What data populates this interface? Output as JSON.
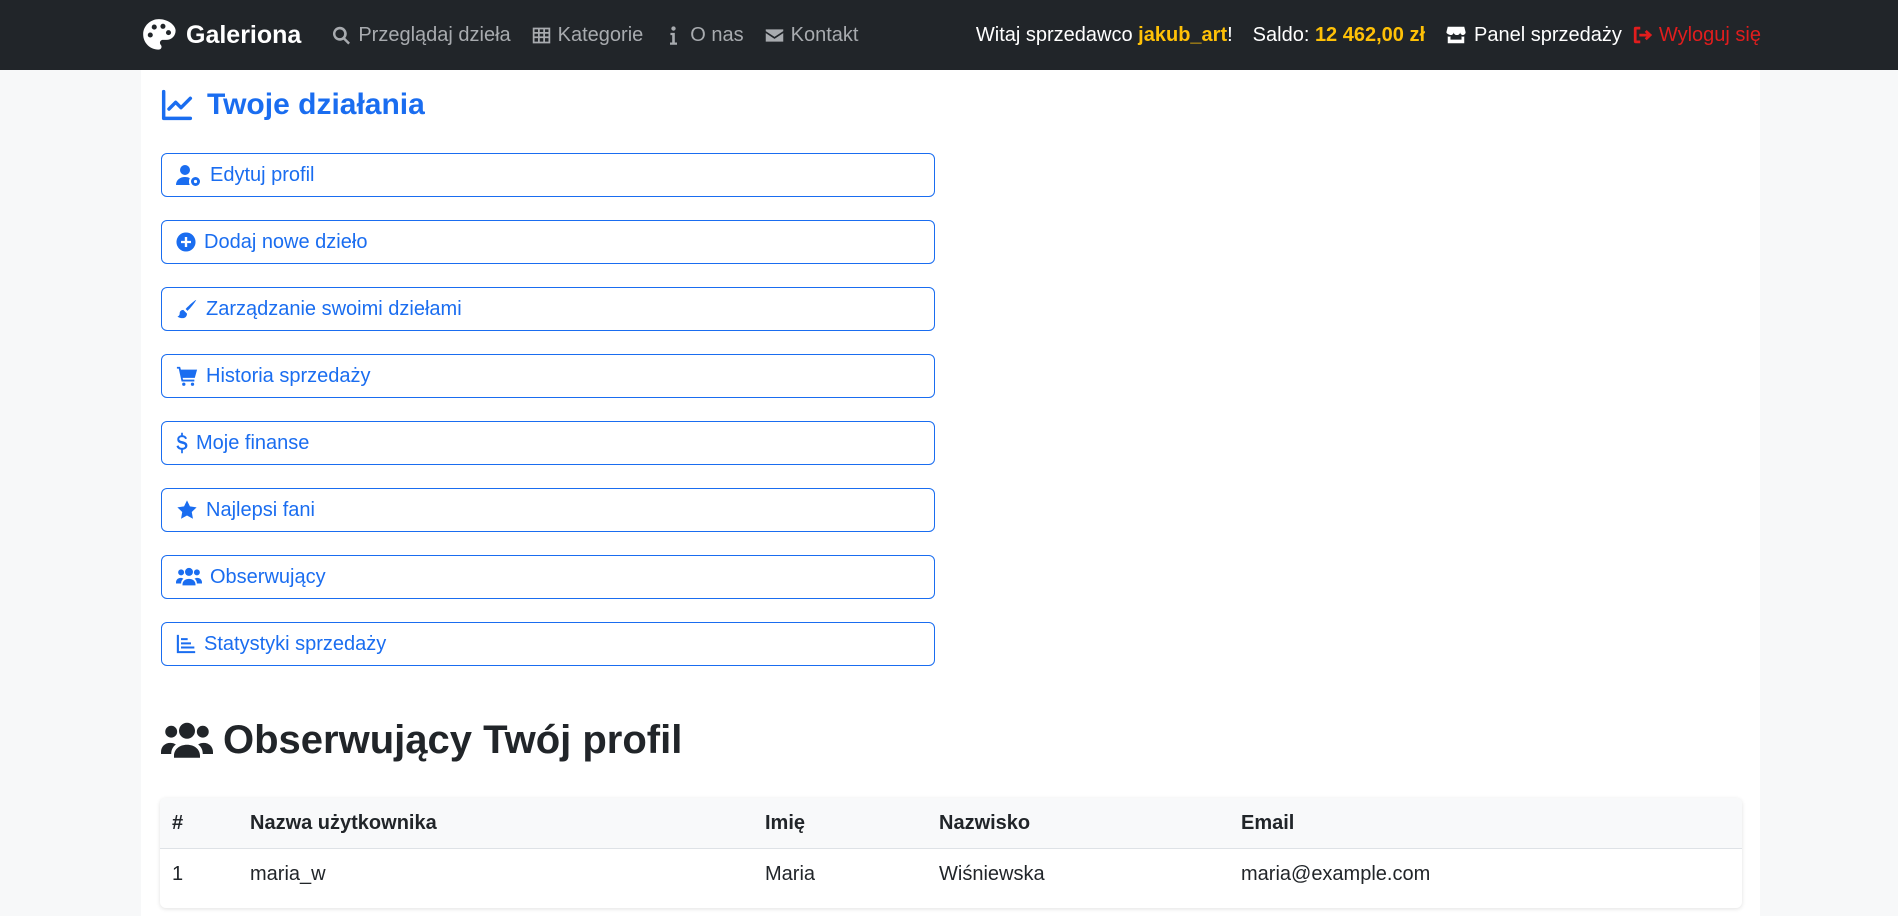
{
  "colors": {
    "navbar_bg": "#212529",
    "accent": "#1a6df0",
    "highlight": "#ffc107",
    "logout": "#e11d1d"
  },
  "navbar": {
    "brand": "Galeriona",
    "links": [
      {
        "label": "Przeglądaj dzieła",
        "icon": "search-icon"
      },
      {
        "label": "Kategorie",
        "icon": "grid-icon"
      },
      {
        "label": "O nas",
        "icon": "info-icon"
      },
      {
        "label": "Kontakt",
        "icon": "envelope-icon"
      }
    ],
    "greeting": "Witaj sprzedawco ",
    "username": "jakub_art",
    "greeting_suffix": "!",
    "balance_label": "Saldo: ",
    "balance_value": "12 462,00 zł",
    "panel_label": "Panel sprzedaży",
    "logout_label": "Wyloguj się"
  },
  "actions": {
    "title": "Twoje działania",
    "items": [
      {
        "label": "Edytuj profil",
        "icon": "user-gear-icon"
      },
      {
        "label": "Dodaj nowe dzieło",
        "icon": "plus-circle-icon"
      },
      {
        "label": "Zarządzanie swoimi dziełami",
        "icon": "brush-icon"
      },
      {
        "label": "Historia sprzedaży",
        "icon": "cart-icon"
      },
      {
        "label": "Moje finanse",
        "icon": "dollar-icon"
      },
      {
        "label": "Najlepsi fani",
        "icon": "star-icon"
      },
      {
        "label": "Obserwujący",
        "icon": "users-icon"
      },
      {
        "label": "Statystyki sprzedaży",
        "icon": "chart-bar-icon"
      }
    ]
  },
  "followers": {
    "title": "Obserwujący Twój profil",
    "columns": [
      "#",
      "Nazwa użytkownika",
      "Imię",
      "Nazwisko",
      "Email"
    ],
    "rows": [
      [
        "1",
        "maria_w",
        "Maria",
        "Wiśniewska",
        "maria@example.com"
      ]
    ]
  }
}
